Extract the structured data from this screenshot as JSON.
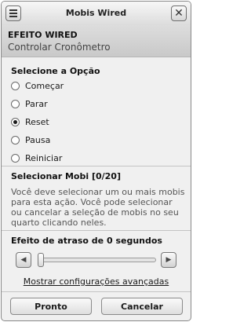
{
  "window": {
    "title": "Mobis Wired",
    "menu_icon": "hamburger-menu-icon",
    "close_icon": "close-x-icon"
  },
  "header": {
    "title": "EFEITO WIRED",
    "subtitle": "Controlar Cronômetro"
  },
  "options": {
    "title": "Selecione a Opção",
    "items": [
      {
        "label": "Começar",
        "checked": false
      },
      {
        "label": "Parar",
        "checked": false
      },
      {
        "label": "Reset",
        "checked": true
      },
      {
        "label": "Pausa",
        "checked": false
      },
      {
        "label": "Reiniciar",
        "checked": false
      }
    ]
  },
  "mobi": {
    "title": "Selecionar Mobi [0/20]",
    "description": "Você deve selecionar um ou mais mobis para esta ação. Você pode selecionar ou cancelar a seleção de mobis no seu quarto clicando neles."
  },
  "delay": {
    "title": "Efeito de atraso de 0 segundos",
    "value_fraction": 0,
    "left_icon": "arrow-left-icon",
    "right_icon": "arrow-right-icon"
  },
  "advanced_link": "Mostrar configurações avançadas",
  "footer": {
    "ok_label": "Pronto",
    "cancel_label": "Cancelar"
  }
}
